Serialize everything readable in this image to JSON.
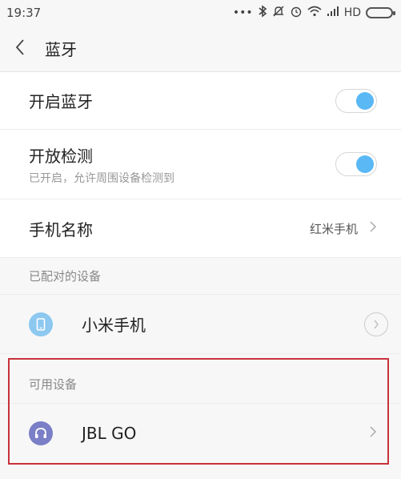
{
  "status": {
    "time": "19:37",
    "network": "HD"
  },
  "header": {
    "title": "蓝牙"
  },
  "settings": {
    "bluetooth": {
      "label": "开启蓝牙",
      "on": true
    },
    "discoverable": {
      "label": "开放检测",
      "sub": "已开启，允许周围设备检测到",
      "on": true
    },
    "phone_name": {
      "label": "手机名称",
      "value": "红米手机"
    }
  },
  "paired": {
    "section_label": "已配对的设备",
    "devices": [
      {
        "name": "小米手机",
        "icon": "phone-icon"
      }
    ]
  },
  "available": {
    "section_label": "可用设备",
    "devices": [
      {
        "name": "JBL GO",
        "icon": "headphones-icon"
      }
    ]
  },
  "colors": {
    "accent": "#5ab8f5",
    "highlight": "#c8323a",
    "headphone": "#7b7fc7",
    "phone": "#8cc8f0"
  }
}
